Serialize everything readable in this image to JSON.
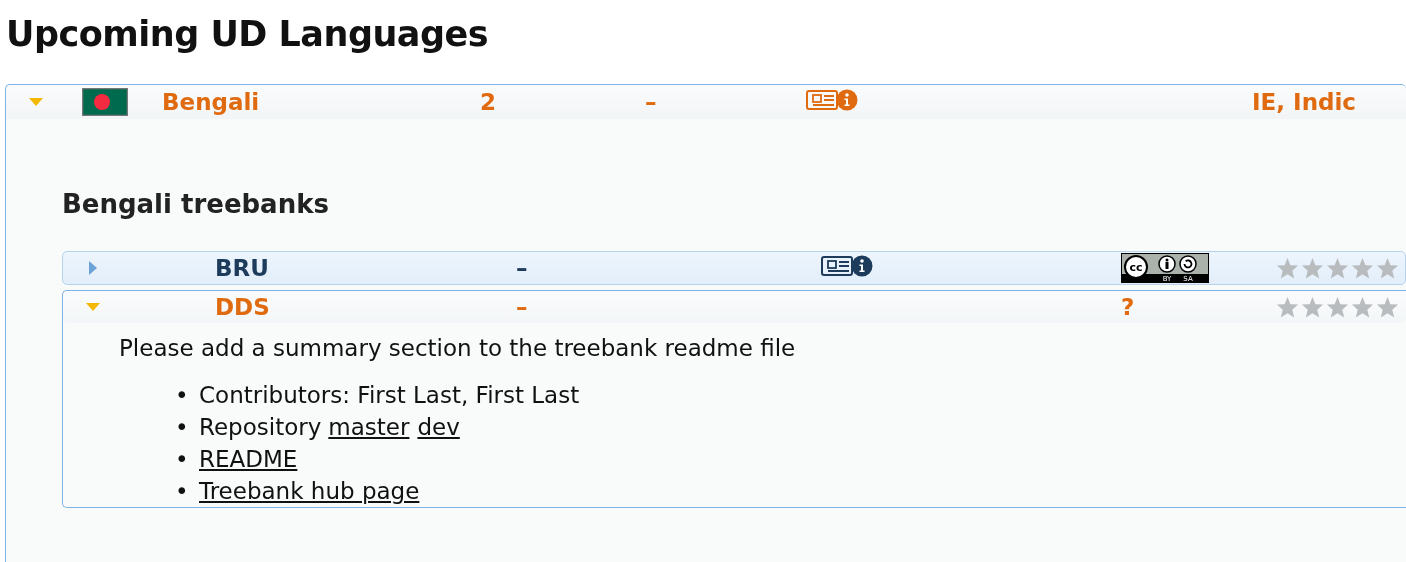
{
  "title": "Upcoming UD Languages",
  "language": {
    "expanded": true,
    "name": "Bengali",
    "count": "2",
    "size": "–",
    "family": "IE, Indic",
    "heading": "Bengali treebanks",
    "treebanks": [
      {
        "name": "BRU",
        "expanded": false,
        "size": "–",
        "has_docs": true,
        "license": {
          "kind": "badge",
          "labels": [
            "cc",
            "BY",
            "SA"
          ]
        },
        "stars": 0
      },
      {
        "name": "DDS",
        "expanded": true,
        "size": "–",
        "has_docs": false,
        "license": {
          "kind": "text",
          "text": "?"
        },
        "stars": 0,
        "summary": "Please add a summary section to the treebank readme file",
        "details": [
          {
            "bullet": "•",
            "parts": [
              {
                "kind": "text",
                "text": "Contributors: First Last, First Last"
              }
            ]
          },
          {
            "bullet": "•",
            "parts": [
              {
                "kind": "text",
                "text": "Repository"
              },
              {
                "kind": "link",
                "text": "master"
              },
              {
                "kind": "link",
                "text": "dev"
              }
            ]
          },
          {
            "bullet": "•",
            "parts": [
              {
                "kind": "link",
                "text": "README"
              }
            ]
          },
          {
            "bullet": "•",
            "parts": [
              {
                "kind": "link",
                "text": "Treebank hub page"
              }
            ]
          }
        ]
      }
    ]
  }
}
